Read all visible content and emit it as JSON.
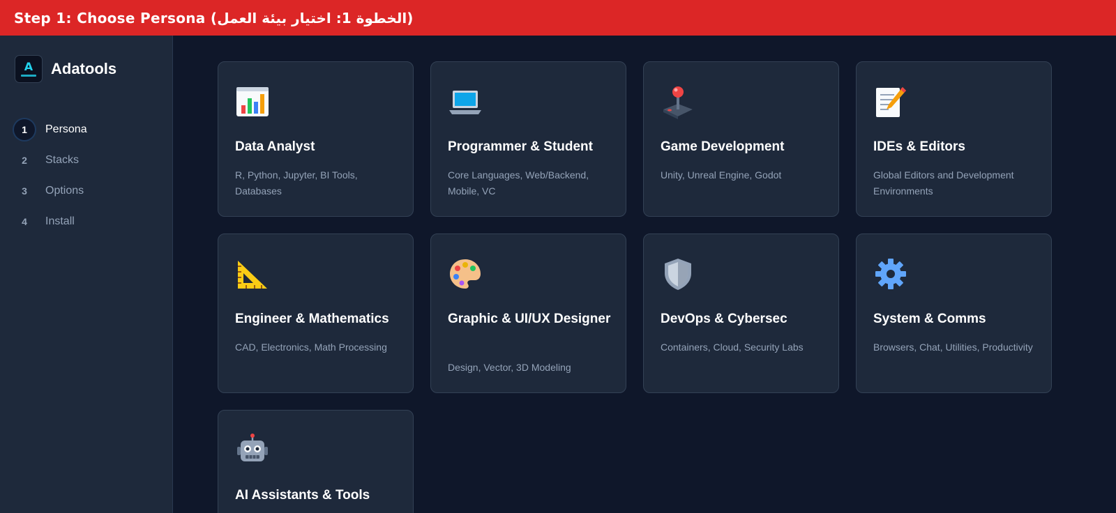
{
  "banner": {
    "text": "Step 1: Choose Persona (الخطوة 1: اختيار بيئة العمل)"
  },
  "brand": {
    "name": "Adatools",
    "logo_text": "A"
  },
  "steps": [
    {
      "num": "1",
      "label": "Persona",
      "active": true
    },
    {
      "num": "2",
      "label": "Stacks",
      "active": false
    },
    {
      "num": "3",
      "label": "Options",
      "active": false
    },
    {
      "num": "4",
      "label": "Install",
      "active": false
    }
  ],
  "personas": [
    {
      "icon": "bar-chart-icon",
      "title": "Data Analyst",
      "desc": "R, Python, Jupyter, BI Tools, Databases"
    },
    {
      "icon": "laptop-icon",
      "title": "Programmer & Student",
      "desc": "Core Languages, Web/Backend, Mobile, VC"
    },
    {
      "icon": "joystick-icon",
      "title": "Game Development",
      "desc": "Unity, Unreal Engine, Godot"
    },
    {
      "icon": "memo-icon",
      "title": "IDEs & Editors",
      "desc": "Global Editors and Development Environments"
    },
    {
      "icon": "triangle-ruler-icon",
      "title": "Engineer & Mathematics",
      "desc": "CAD, Electronics, Math Processing"
    },
    {
      "icon": "palette-icon",
      "title": "Graphic & UI/UX Designer",
      "desc": "Design, Vector, 3D Modeling"
    },
    {
      "icon": "shield-icon",
      "title": "DevOps & Cybersec",
      "desc": "Containers, Cloud, Security Labs"
    },
    {
      "icon": "gear-icon",
      "title": "System & Comms",
      "desc": "Browsers, Chat, Utilities, Productivity"
    },
    {
      "icon": "robot-icon",
      "title": "AI Assistants & Tools",
      "desc": ""
    }
  ],
  "colors": {
    "banner": "#dc2626",
    "background": "#0f172a",
    "sidebar": "#1e293b",
    "card": "#1e293b",
    "accent": "#22d3ee"
  }
}
